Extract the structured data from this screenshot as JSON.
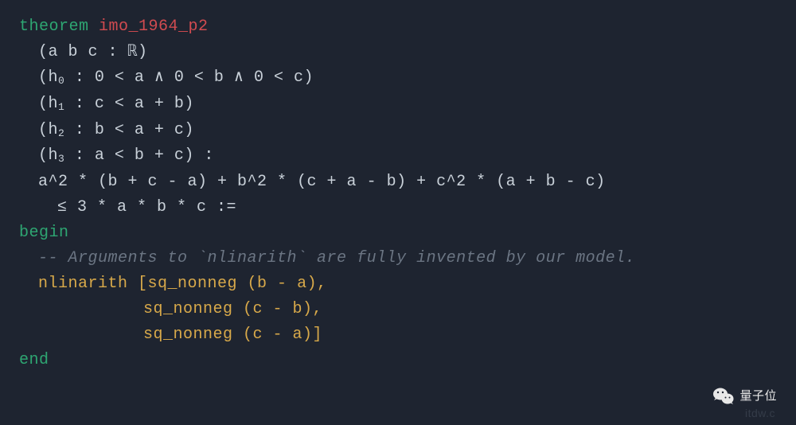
{
  "code": {
    "line1_kw": "theorem",
    "line1_name": " imo_1964_p2",
    "line2": "(a b c : ℝ)",
    "line3_pre": "(h",
    "line3_sub": "0",
    "line3_post": " : 0 < a ∧ 0 < b ∧ 0 < c)",
    "line4_pre": "(h",
    "line4_sub": "1",
    "line4_post": " : c < a + b)",
    "line5_pre": "(h",
    "line5_sub": "2",
    "line5_post": " : b < a + c)",
    "line6_pre": "(h",
    "line6_sub": "3",
    "line6_post": " : a < b + c) :",
    "line7": "a^2 * (b + c - a) + b^2 * (c + a - b) + c^2 * (a + b - c)",
    "line8": "≤ 3 * a * b * c :=",
    "line9_begin": "begin",
    "line10_comment": "-- Arguments to `nlinarith` are fully invented by our model.",
    "line11_tactic": "nlinarith",
    "line11_args": " [sq_nonneg (b - a),",
    "line12_args": "sq_nonneg (c - b),",
    "line13_args": "sq_nonneg (c - a)]",
    "line14_end": "end"
  },
  "watermark": {
    "text": "量子位",
    "faded": "itdw.c"
  }
}
